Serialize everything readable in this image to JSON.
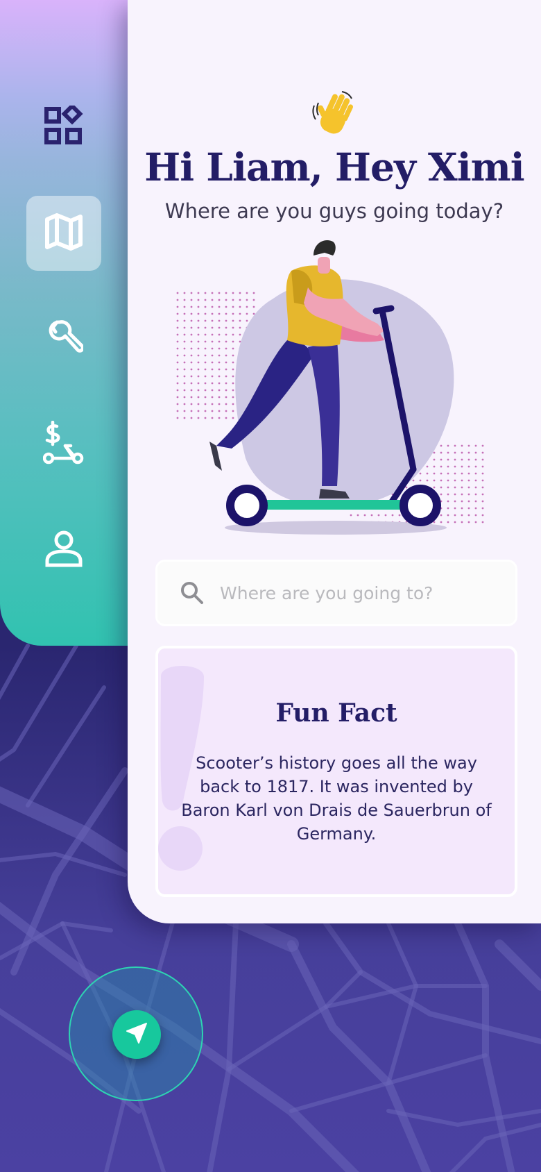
{
  "sidebar": {
    "items": [
      {
        "icon": "apps-icon",
        "active": false
      },
      {
        "icon": "map-icon",
        "active": true
      },
      {
        "icon": "wrench-icon",
        "active": false
      },
      {
        "icon": "scooter-pricing-icon",
        "active": false
      },
      {
        "icon": "user-icon",
        "active": false
      }
    ]
  },
  "header": {
    "wave_emoji": "👋",
    "greeting": "Hi Liam, Hey Ximi",
    "subtitle": "Where are you guys going today?"
  },
  "search": {
    "placeholder": "Where are you going to?",
    "value": ""
  },
  "fun_fact": {
    "title": "Fun Fact",
    "body": "Scooter’s history goes all the way back to 1817. It was invented by Baron Karl von Drais de Sauerbrun of Germany."
  },
  "map": {
    "locate_icon": "navigation-arrow-icon"
  },
  "colors": {
    "primary": "#231d66",
    "accent": "#17c89d",
    "card_bg": "#f8f3fd",
    "fun_fact_bg": "#f4e8fc",
    "scooter_frame": "#1c1369",
    "scooter_deck": "#20c598",
    "shirt": "#e6b72d",
    "pants": "#3a2f96"
  }
}
